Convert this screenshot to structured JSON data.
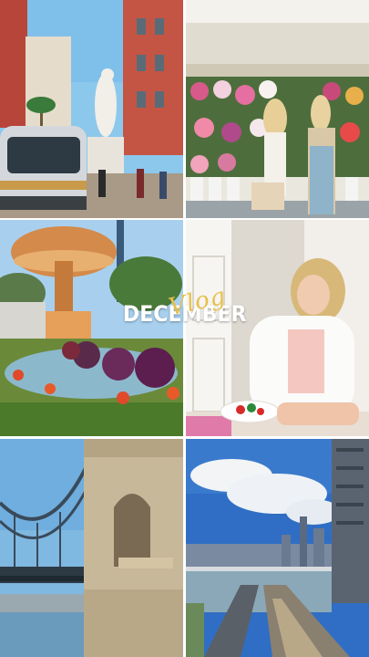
{
  "title": {
    "script_word": "Vlog",
    "main_word": "DECEMBER",
    "script_color": "#e8c04a",
    "main_color": "#ffffff"
  },
  "photos": [
    {
      "subject": "tram-statue-square"
    },
    {
      "subject": "flower-market"
    },
    {
      "subject": "carousel-garden"
    },
    {
      "subject": "woman-fruit-plate"
    },
    {
      "subject": "chain-bridge"
    },
    {
      "subject": "city-skyline-river"
    }
  ]
}
